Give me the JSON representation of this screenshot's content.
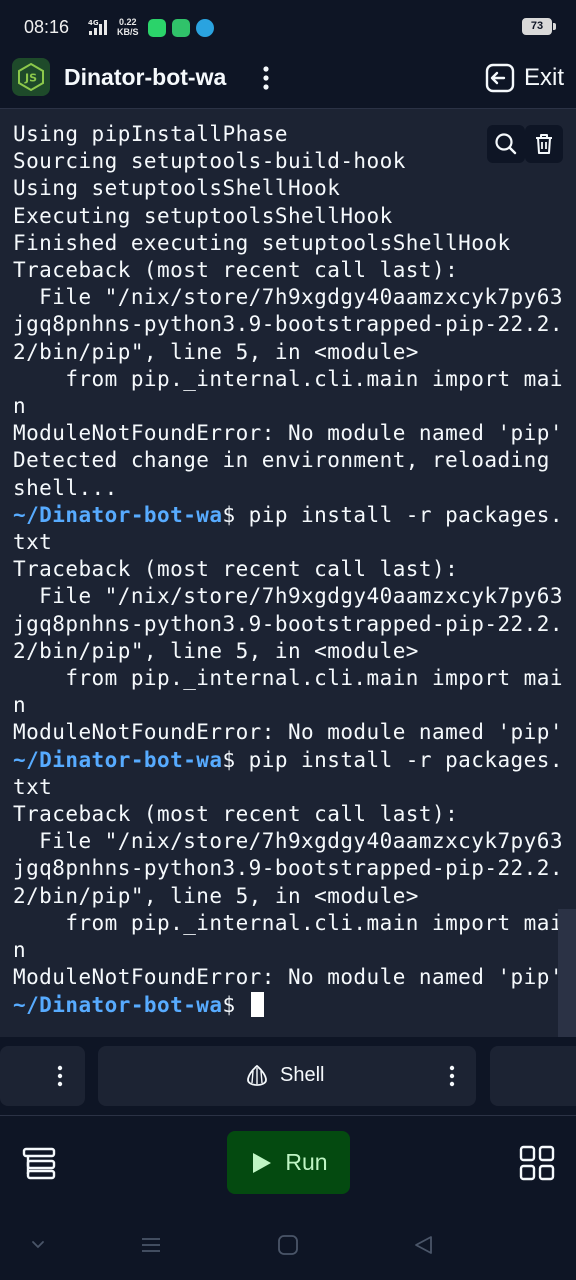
{
  "status_bar": {
    "time": "08:16",
    "network": "4G",
    "speed_value": "0.22",
    "speed_unit": "KB/S",
    "battery": "73"
  },
  "header": {
    "title": "Dinator-bot-wa",
    "exit_label": "Exit"
  },
  "terminal": {
    "prompt": "~/Dinator-bot-wa",
    "lines": [
      {
        "text": "Using pipInstallPhase"
      },
      {
        "text": "Sourcing setuptools-build-hook"
      },
      {
        "text": "Using setuptoolsShellHook"
      },
      {
        "text": "Executing setuptoolsShellHook"
      },
      {
        "text": "Finished executing setuptoolsShellHook"
      },
      {
        "text": "Traceback (most recent call last):"
      },
      {
        "text": "  File \"/nix/store/7h9xgdgy40aamzxcyk7py63"
      },
      {
        "text": "jgq8pnhns-python3.9-bootstrapped-pip-22.2."
      },
      {
        "text": "2/bin/pip\", line 5, in <module>"
      },
      {
        "text": "    from pip._internal.cli.main import mai"
      },
      {
        "text": "n"
      },
      {
        "text": "ModuleNotFoundError: No module named 'pip'"
      },
      {
        "text": "Detected change in environment, reloading"
      },
      {
        "text": "shell..."
      },
      {
        "prompt": true,
        "text": "$ pip install -r packages."
      },
      {
        "text": "txt"
      },
      {
        "text": "Traceback (most recent call last):"
      },
      {
        "text": "  File \"/nix/store/7h9xgdgy40aamzxcyk7py63"
      },
      {
        "text": "jgq8pnhns-python3.9-bootstrapped-pip-22.2."
      },
      {
        "text": "2/bin/pip\", line 5, in <module>"
      },
      {
        "text": "    from pip._internal.cli.main import mai"
      },
      {
        "text": "n"
      },
      {
        "text": "ModuleNotFoundError: No module named 'pip'"
      },
      {
        "prompt": true,
        "text": "$ pip install -r packages."
      },
      {
        "text": "txt"
      },
      {
        "text": "Traceback (most recent call last):"
      },
      {
        "text": "  File \"/nix/store/7h9xgdgy40aamzxcyk7py63"
      },
      {
        "text": "jgq8pnhns-python3.9-bootstrapped-pip-22.2."
      },
      {
        "text": "2/bin/pip\", line 5, in <module>"
      },
      {
        "text": "    from pip._internal.cli.main import mai"
      },
      {
        "text": "n"
      },
      {
        "text": "ModuleNotFoundError: No module named 'pip'"
      },
      {
        "prompt": true,
        "text": "$ ",
        "cursor": true
      }
    ]
  },
  "tabs": {
    "shell_label": "Shell"
  },
  "toolbar": {
    "run_label": "Run"
  },
  "colors": {
    "background": "#0e1525",
    "terminal_bg": "#1c2333",
    "prompt": "#57abff",
    "run_button": "#044a10",
    "run_text": "#bff5c4"
  },
  "icons": {
    "search": "search-icon",
    "trash": "trash-icon",
    "exit": "exit-icon",
    "shell": "shell-icon",
    "run": "play-icon",
    "files": "files-icon",
    "apps": "apps-grid-icon"
  }
}
